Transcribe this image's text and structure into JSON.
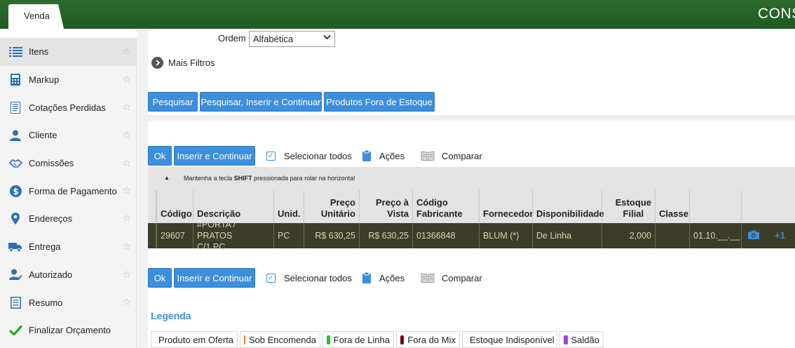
{
  "header": {
    "tab_label": "Venda",
    "title": "CONS"
  },
  "sidebar": {
    "items": [
      {
        "label": "Itens",
        "icon": "list-icon",
        "active": true
      },
      {
        "label": "Markup",
        "icon": "calculator-icon"
      },
      {
        "label": "Cotações Perdidas",
        "icon": "document-list-icon"
      },
      {
        "label": "Cliente",
        "icon": "user-icon"
      },
      {
        "label": "Comissões",
        "icon": "handshake-icon"
      },
      {
        "label": "Forma de Pagamento",
        "icon": "dollar-icon"
      },
      {
        "label": "Endereços",
        "icon": "map-pin-icon"
      },
      {
        "label": "Entrega",
        "icon": "truck-icon"
      },
      {
        "label": "Autorizado",
        "icon": "user-check-icon"
      },
      {
        "label": "Resumo",
        "icon": "document-icon"
      },
      {
        "label": "Finalizar Orçamento",
        "icon": "checkmark-icon"
      }
    ]
  },
  "filters": {
    "ordem_label": "Ordem",
    "ordem_value": "Alfabética",
    "mais_filtros": "Mais Filtros"
  },
  "buttons": {
    "pesquisar": "Pesquisar",
    "pesquisar_inserir": "Pesquisar, Inserir e Continuar",
    "fora_estoque": "Produtos Fora de Estoque",
    "ok": "Ok",
    "inserir_continuar": "Inserir e Continuar"
  },
  "toolbar": {
    "selecionar_todos": "Selecionar todos",
    "acoes": "Ações",
    "comparar": "Comparar"
  },
  "table": {
    "hint_prefix": "Mantenha a tecla ",
    "hint_key": "SHIFT",
    "hint_suffix": " pressionada para rolar na horizontal",
    "headers": {
      "codigo": "Código",
      "descricao": "Descrição",
      "unid": "Unid.",
      "preco_unitario_1": "Preço",
      "preco_unitario_2": "Unitário",
      "preco_vista_1": "Preço à",
      "preco_vista_2": "Vista",
      "codigo_fab_1": "Código",
      "codigo_fab_2": "Fabricante",
      "fornecedor": "Fornecedor",
      "disponibilidade": "Disponibilidade",
      "estoque_1": "Estoque",
      "estoque_2": "Filial",
      "classe": "Classe"
    },
    "row": {
      "codigo": "29607",
      "descricao_1": "#PORTA / PRATOS",
      "descricao_2": "C/1 PC",
      "unid": "PC",
      "preco_unitario": "R$ 630,25",
      "preco_vista": "R$ 630,25",
      "codigo_fab": "01366848",
      "fornecedor": "BLUM (*)",
      "disponibilidade": "De Linha",
      "estoque": "2,000",
      "classe": "",
      "data": "01.10.__.__",
      "extra": "+1"
    }
  },
  "legenda": {
    "title": "Legenda",
    "items": [
      {
        "label": "Produto em Oferta",
        "color": "#0000ee"
      },
      {
        "label": "Sob Encomenda",
        "color": "#f07d1a"
      },
      {
        "label": "Fora de Linha",
        "color": "#22c322"
      },
      {
        "label": "Fora do Mix",
        "color": "#7a0a0a"
      },
      {
        "label": "Estoque Indisponível",
        "color": "#ee1111"
      },
      {
        "label": "Saldão",
        "color": "#a640e0"
      }
    ]
  }
}
